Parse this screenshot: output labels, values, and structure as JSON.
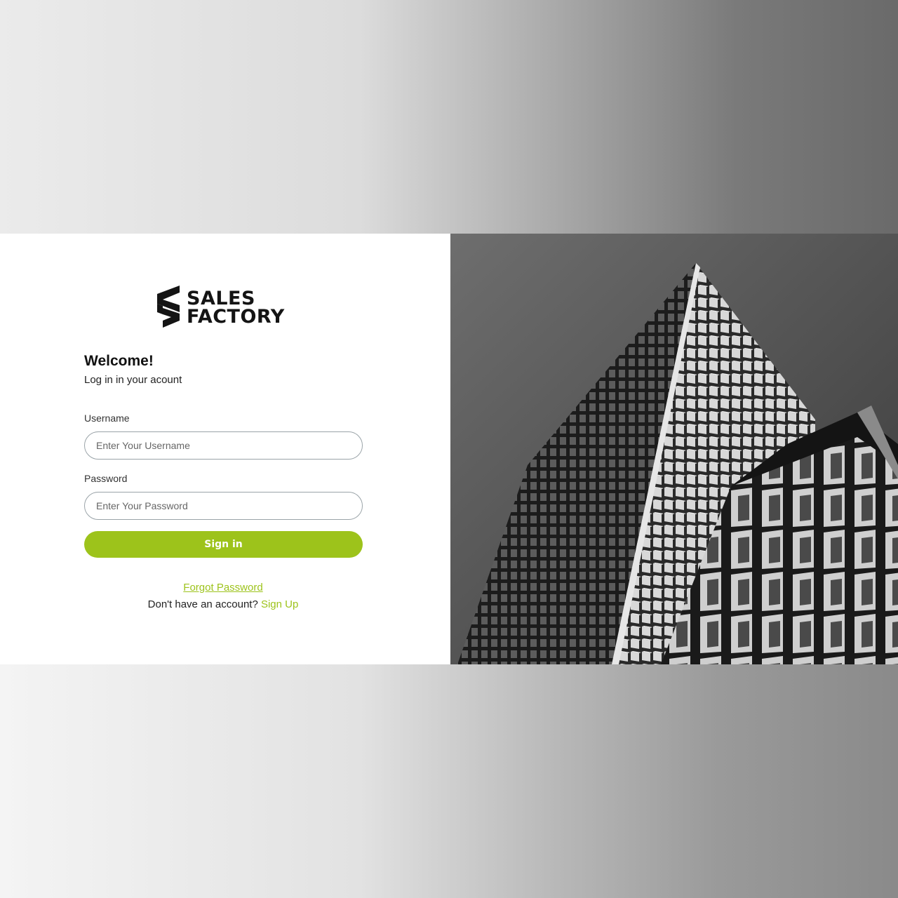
{
  "brand": {
    "name_line1": "SALES",
    "name_line2": "FACTORY"
  },
  "login": {
    "title": "Welcome!",
    "subtitle": "Log in in your acount",
    "username_label": "Username",
    "username_placeholder": "Enter Your Username",
    "password_label": "Password",
    "password_placeholder": "Enter Your Password",
    "signin_label": "Sign in",
    "forgot_label": "Forgot Password",
    "no_account_text": "Don't have an account? ",
    "signup_label": "Sign Up"
  },
  "hero_image": {
    "subject": "building-photo"
  },
  "colors": {
    "accent": "#9dc31b",
    "text": "#111111"
  }
}
